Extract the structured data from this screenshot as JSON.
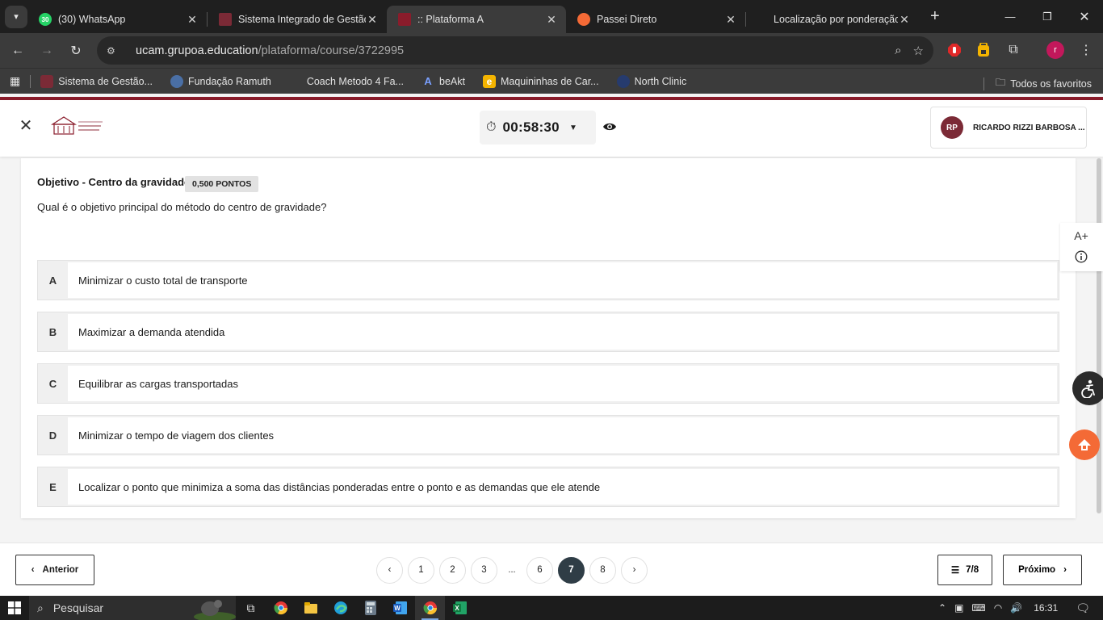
{
  "browser": {
    "tabs": [
      {
        "title": "(30) WhatsApp",
        "favicon": "whatsapp-icon",
        "badge": "30",
        "active": false
      },
      {
        "title": "Sistema Integrado de Gestão",
        "favicon": "university-icon",
        "active": false
      },
      {
        "title": ":: Plataforma A",
        "favicon": "plataforma-icon",
        "active": true
      },
      {
        "title": "Passei Direto",
        "favicon": "passei-direto-icon",
        "active": false
      },
      {
        "title": "Localização por ponderação",
        "favicon": "",
        "active": false
      }
    ],
    "url_host": "ucam.grupoa.education",
    "url_path": "/plataforma/course/3722995",
    "profile_initial": "r",
    "bookmarks": [
      {
        "label": "Sistema de Gestão...",
        "icon": "university-icon"
      },
      {
        "label": "Fundação Ramuth",
        "icon": "headphones-icon"
      },
      {
        "label": "Coach Metodo 4 Fa...",
        "icon": ""
      },
      {
        "label": "beAkt",
        "icon": "beakt-icon"
      },
      {
        "label": "Maquininhas de Car...",
        "icon": "e-icon"
      },
      {
        "label": "North Clinic",
        "icon": "clinic-icon"
      }
    ],
    "all_bookmarks_label": "Todos os favoritos"
  },
  "header": {
    "timer": "00:58:30",
    "user_initials": "RP",
    "user_name": "RICARDO RIZZI BARBOSA ..."
  },
  "question": {
    "title": "Objetivo - Centro da gravidade",
    "points": "0,500 PONTOS",
    "text": "Qual é o objetivo principal do método do centro de gravidade?",
    "options": [
      {
        "letter": "A",
        "text": "Minimizar o custo total de transporte"
      },
      {
        "letter": "B",
        "text": "Maximizar a demanda atendida"
      },
      {
        "letter": "C",
        "text": "Equilibrar as cargas transportadas"
      },
      {
        "letter": "D",
        "text": "Minimizar o tempo de viagem dos clientes"
      },
      {
        "letter": "E",
        "text": "Localizar o ponto que minimiza a soma das distâncias ponderadas entre o ponto e as demandas que ele atende"
      }
    ]
  },
  "side_tools": {
    "font_size_label": "A+",
    "info_label": "i"
  },
  "footer": {
    "prev_label": "Anterior",
    "next_label": "Próximo",
    "pages": [
      "1",
      "2",
      "3",
      "...",
      "6",
      "7",
      "8"
    ],
    "current_page": "7",
    "progress": "7/8"
  },
  "taskbar": {
    "search_placeholder": "Pesquisar",
    "time": "16:31"
  },
  "colors": {
    "brand": "#8a1c2b",
    "avatar": "#7b2a36",
    "active_page": "#2f3d46",
    "chrome_dark": "#1f1f1f",
    "chrome_mid": "#3b3b3b",
    "passei_direto": "#f46a36"
  }
}
